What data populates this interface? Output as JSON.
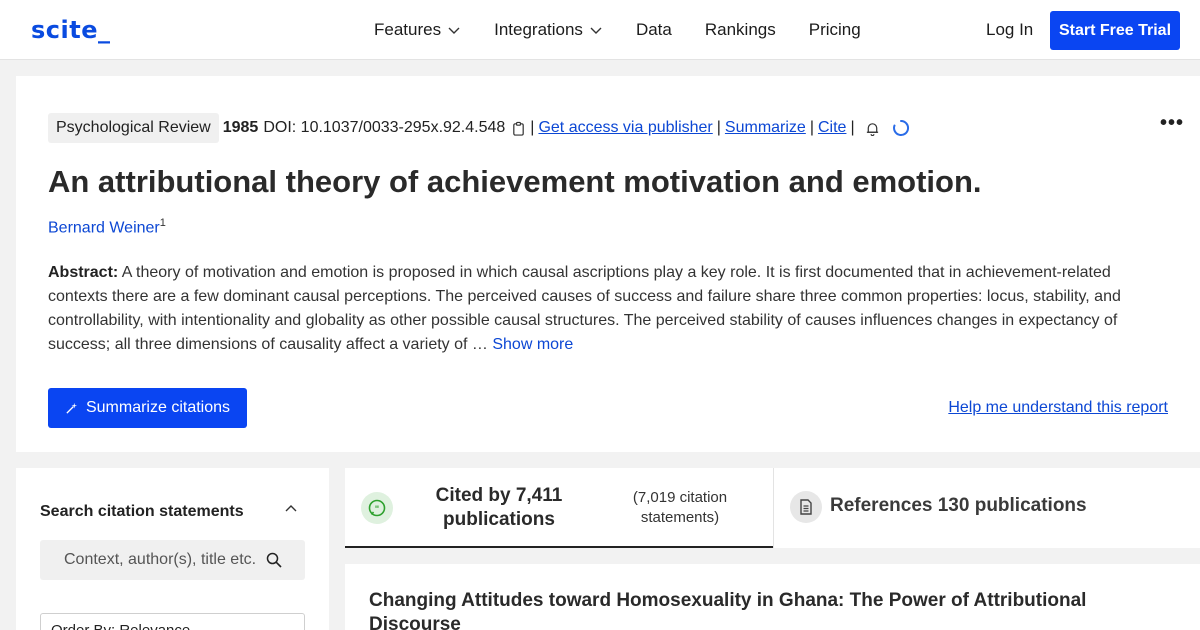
{
  "header": {
    "logo": "scite_",
    "nav": [
      {
        "label": "Features",
        "dropdown": true
      },
      {
        "label": "Integrations",
        "dropdown": true
      },
      {
        "label": "Data",
        "dropdown": false
      },
      {
        "label": "Rankings",
        "dropdown": false
      },
      {
        "label": "Pricing",
        "dropdown": false
      }
    ],
    "login": "Log In",
    "cta": "Start Free Trial"
  },
  "paper": {
    "journal": "Psychological Review",
    "year": "1985",
    "doi": "DOI: 10.1037/0033-295x.92.4.548",
    "links": {
      "access": "Get access via publisher",
      "summarize": "Summarize",
      "cite": "Cite"
    },
    "title": "An attributional theory of achievement motivation and emotion.",
    "author": "Bernard Weiner",
    "author_sup": "1",
    "abstract_label": "Abstract:",
    "abstract_text": "A theory of motivation and emotion is proposed in which causal ascriptions play a key role. It is first documented that in achievement-related contexts there are a few dominant causal perceptions. The perceived causes of success and failure share three common properties: locus, stability, and controllability, with intentionality and globality as other possible causal structures. The perceived stability of causes influences changes in expectancy of success; all three dimensions of causality affect a variety of …",
    "show_more": "Show more",
    "summarize_button": "Summarize citations",
    "help_link": "Help me understand this report"
  },
  "left_panel": {
    "title": "Search citation statements",
    "search_placeholder": "Context, author(s), title etc.",
    "order_by": "Order By: Relevance"
  },
  "tabs": {
    "cited_main": "Cited by 7,411 publications",
    "cited_sub": "(7,019 citation statements)",
    "references": "References 130 publications"
  },
  "results": [
    {
      "title": "Changing Attitudes toward Homosexuality in Ghana: The Power of Attributional Discourse"
    }
  ],
  "colors": {
    "brand": "#0a45f2",
    "link": "#0c47d4",
    "cited_icon_bg": "#dff1df",
    "cited_icon": "#2ea12e"
  }
}
